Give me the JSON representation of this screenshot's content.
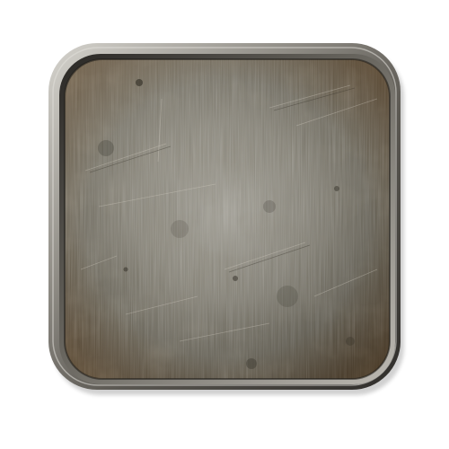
{
  "icon": {
    "name": "metal-plate-icon",
    "colors": {
      "background": "#ffffff",
      "rim_light": "#c9c7c1",
      "rim_mid": "#8d8a83",
      "rim_dark": "#3e3c38",
      "plate_light": "#a8a599",
      "plate_mid": "#6f6a5d",
      "plate_dark": "#3f3b32",
      "rust": "#7a5a30"
    }
  }
}
